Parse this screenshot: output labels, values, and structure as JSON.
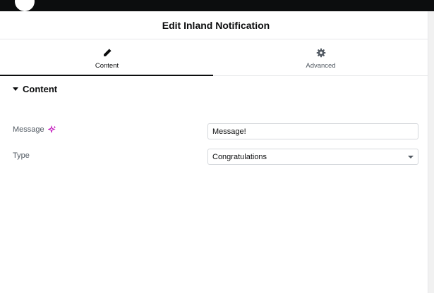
{
  "header": {
    "title": "Edit Inland Notification"
  },
  "tabs": [
    {
      "label": "Content",
      "icon": "pencil-icon",
      "active": true
    },
    {
      "label": "Advanced",
      "icon": "gear-icon",
      "active": false
    }
  ],
  "section": {
    "title": "Content"
  },
  "fields": {
    "message": {
      "label": "Message",
      "value": "Message!",
      "ai_icon": "ai-sparkle-icon"
    },
    "type": {
      "label": "Type",
      "selected": "Congratulations"
    }
  },
  "colors": {
    "topbar": "#0c0d0e",
    "active_tab_indicator": "#0c0d0e",
    "ai_icon": "#c00bb9",
    "border": "#d5d8dc"
  }
}
